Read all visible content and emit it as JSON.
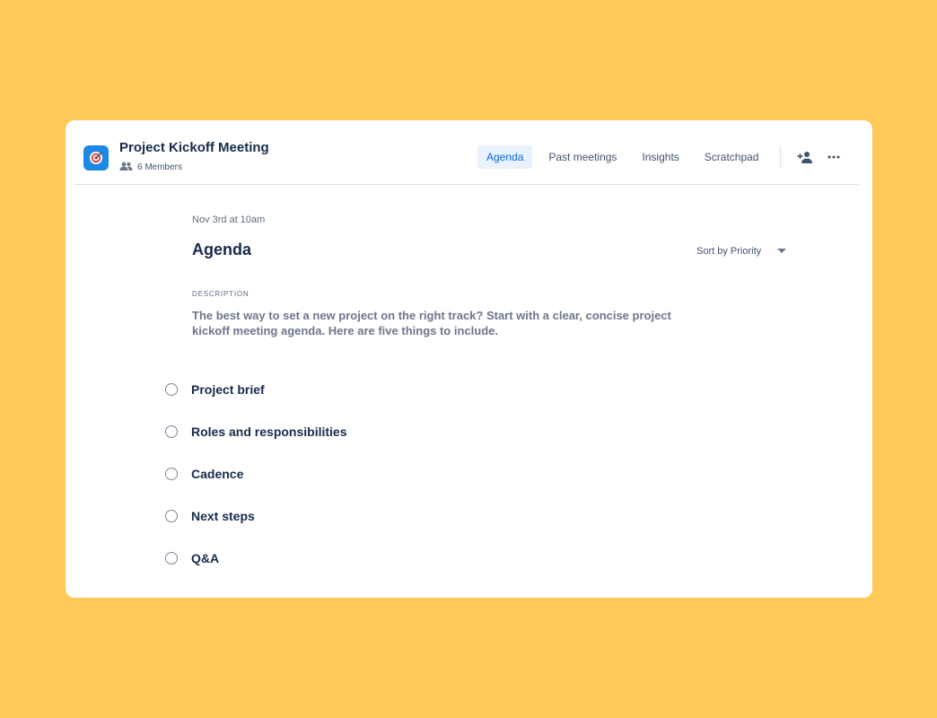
{
  "meeting": {
    "title": "Project Kickoff Meeting",
    "members": "6 Members",
    "icon": "target-icon"
  },
  "tabs": [
    {
      "label": "Agenda",
      "active": true
    },
    {
      "label": "Past meetings",
      "active": false
    },
    {
      "label": "Insights",
      "active": false
    },
    {
      "label": "Scratchpad",
      "active": false
    }
  ],
  "actions": {
    "add_member_icon": "add-person-icon",
    "more_icon": "more-icon"
  },
  "main": {
    "date": "Nov 3rd at 10am",
    "heading": "Agenda",
    "sort_label": "Sort by Priority",
    "description_label": "DESCRIPTION",
    "description": "The best way to set a new project on the right track? Start with a clear, concise project kickoff meeting agenda. Here are five things to include."
  },
  "agenda_items": [
    {
      "label": "Project brief"
    },
    {
      "label": "Roles and responsibilities"
    },
    {
      "label": "Cadence"
    },
    {
      "label": "Next steps"
    },
    {
      "label": "Q&A"
    }
  ],
  "colors": {
    "background": "#FFC857",
    "accent": "#0C66E4",
    "active_tab_bg": "#E9F2FF",
    "app_icon": "#1E88E5"
  }
}
